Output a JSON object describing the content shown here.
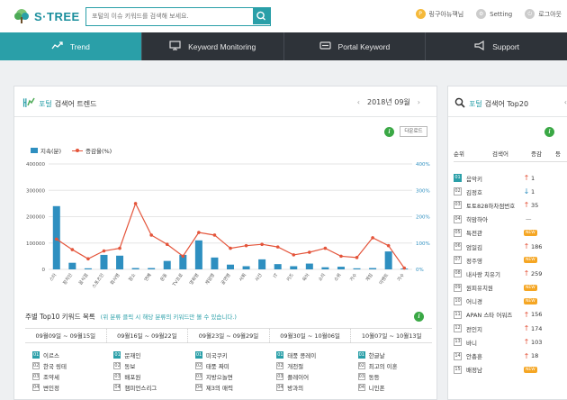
{
  "brand": {
    "name": "S·TREE",
    "accent": "#2a9fa8"
  },
  "search": {
    "placeholder": "포털의 이슈 키워드를 검색해 보세요."
  },
  "user_menu": {
    "user": "링구아뉴잭님",
    "setting": "Setting",
    "logout": "로그아웃"
  },
  "nav": [
    {
      "label": "Trend",
      "icon": "trend-icon",
      "active": true
    },
    {
      "label": "Keyword Monitoring",
      "icon": "monitor-icon",
      "active": false
    },
    {
      "label": "Portal Keyword",
      "icon": "portal-icon",
      "active": false
    },
    {
      "label": "Support",
      "icon": "megaphone-icon",
      "active": false
    }
  ],
  "trend_panel": {
    "title_prefix": "포털",
    "title": "검색어 트렌드",
    "date": "2018년 09월",
    "download_label": "다운로드",
    "legend": {
      "bar": "지속(분)",
      "line": "증감율(%)"
    }
  },
  "chart_data": {
    "type": "bar",
    "categories": [
      "스타",
      "정치인",
      "음식점",
      "스포츠인",
      "회사명",
      "장소",
      "연예",
      "운동",
      "TV프로",
      "영화명",
      "게임명",
      "공연명",
      "사회",
      "사건",
      "IT",
      "키즈",
      "육아",
      "소리",
      "소위",
      "가수",
      "게임",
      "이벤트",
      "가수"
    ],
    "series": [
      {
        "name": "지속(분)",
        "axis": "left",
        "values": [
          240000,
          25000,
          4000,
          55000,
          52000,
          5000,
          5000,
          32000,
          55000,
          110000,
          45000,
          18000,
          12000,
          38000,
          20000,
          12000,
          22000,
          8000,
          10000,
          4000,
          5000,
          68000,
          3000
        ]
      },
      {
        "name": "증감율(%)",
        "axis": "right",
        "values": [
          115,
          75,
          40,
          70,
          80,
          250,
          130,
          95,
          50,
          140,
          130,
          80,
          90,
          95,
          85,
          55,
          65,
          80,
          50,
          45,
          120,
          90,
          5
        ]
      }
    ],
    "y_left": {
      "min": 0,
      "max": 400000,
      "ticks": [
        0,
        100000,
        200000,
        300000,
        400000
      ]
    },
    "y_right": {
      "min": 0,
      "max": 400,
      "ticks": [
        "0%",
        "100%",
        "200%",
        "300%",
        "400%"
      ]
    },
    "colors": {
      "bar": "#2e8fc0",
      "line": "#e4543a"
    },
    "grid": true
  },
  "weekly": {
    "title": "주별 Top10 키워드 목록",
    "note": "(위 분류 클릭 시 해당 분류의 키워드만 볼 수 있습니다.)",
    "weeks": [
      "09월09일 ~ 09월15일",
      "09월16일 ~ 09월22일",
      "09월23일 ~ 09월29일",
      "09월30일 ~ 10월06일",
      "10월07일 ~ 10월13일"
    ],
    "columns": [
      [
        "이르스",
        "한국 링테",
        "조약세",
        "변인정"
      ],
      [
        "문재인",
        "동보",
        "배포원",
        "챔피언스리그"
      ],
      [
        "미국쿠키",
        "태풍 짜미",
        "지방으놀면",
        "제3의 매력"
      ],
      [
        "태풍 콩레이",
        "개천절",
        "플레이어",
        "방과의"
      ],
      [
        "한글날",
        "최고의 이혼",
        "동등",
        "니인폰"
      ]
    ]
  },
  "top20_panel": {
    "title_prefix": "포털",
    "title": "검색어 Top20",
    "headers": {
      "rank": "순위",
      "keyword": "검색어",
      "change": "증감",
      "status": "등"
    },
    "rows": [
      {
        "rank": "01",
        "kw": "음악키",
        "dir": "up",
        "num": "1"
      },
      {
        "rank": "02",
        "kw": "김정호",
        "dir": "down",
        "num": "1"
      },
      {
        "rank": "03",
        "kw": "토토828하차점번호",
        "dir": "up",
        "num": "35"
      },
      {
        "rank": "04",
        "kw": "히맘하아",
        "dir": "same",
        "num": "—"
      },
      {
        "rank": "05",
        "kw": "특전관",
        "dir": "new",
        "num": "NEW"
      },
      {
        "rank": "06",
        "kw": "엄일김",
        "dir": "up",
        "num": "186"
      },
      {
        "rank": "07",
        "kw": "정주영",
        "dir": "new",
        "num": "NEW"
      },
      {
        "rank": "08",
        "kw": "내사랑 치유기",
        "dir": "up",
        "num": "259"
      },
      {
        "rank": "09",
        "kw": "원피유치원",
        "dir": "new",
        "num": "NEW"
      },
      {
        "rank": "10",
        "kw": "어니경",
        "dir": "new",
        "num": "NEW"
      },
      {
        "rank": "11",
        "kw": "APAN 스타 어워즈",
        "dir": "up",
        "num": "156"
      },
      {
        "rank": "12",
        "kw": "전인지",
        "dir": "up",
        "num": "174"
      },
      {
        "rank": "13",
        "kw": "바니",
        "dir": "up",
        "num": "103"
      },
      {
        "rank": "14",
        "kw": "안총훈",
        "dir": "up",
        "num": "18"
      },
      {
        "rank": "15",
        "kw": "배정남",
        "dir": "new",
        "num": "NEW"
      }
    ]
  }
}
